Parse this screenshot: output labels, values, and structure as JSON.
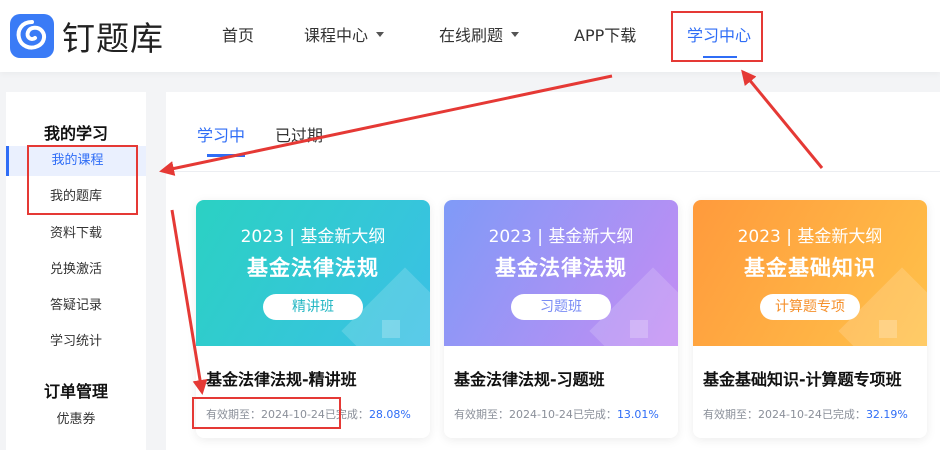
{
  "brand": {
    "name": "钉题库",
    "logo_icon": "swirl-logo-icon"
  },
  "nav": {
    "items": [
      {
        "label": "首页",
        "has_dropdown": false
      },
      {
        "label": "课程中心",
        "has_dropdown": true
      },
      {
        "label": "在线刷题",
        "has_dropdown": true
      },
      {
        "label": "APP下载",
        "has_dropdown": false
      },
      {
        "label": "学习中心",
        "has_dropdown": false,
        "active": true
      }
    ]
  },
  "sidebar": {
    "section1_title": "我的学习",
    "section1_items": [
      "我的课程",
      "我的题库",
      "资料下载",
      "兑换激活",
      "答疑记录",
      "学习统计"
    ],
    "active_item": "我的课程",
    "section2_title": "订单管理",
    "section2_items": [
      "优惠券"
    ]
  },
  "tabs": {
    "items": [
      "学习中",
      "已过期"
    ],
    "active": "学习中"
  },
  "courses": [
    {
      "year_line": "2023 | 基金新大纲",
      "subject": "基金法律法规",
      "pill": "精讲班",
      "title": "基金法律法规-精讲班",
      "validity_label": "有效期至：",
      "validity_date": "2024-10-24",
      "completion_label": "已完成：",
      "progress": "28.08%",
      "gradient": "teal"
    },
    {
      "year_line": "2023 | 基金新大纲",
      "subject": "基金法律法规",
      "pill": "习题班",
      "title": "基金法律法规-习题班",
      "validity_label": "有效期至：",
      "validity_date": "2024-10-24",
      "completion_label": "已完成：",
      "progress": "13.01%",
      "gradient": "purple"
    },
    {
      "year_line": "2023 | 基金新大纲",
      "subject": "基金基础知识",
      "pill": "计算题专项",
      "title": "基金基础知识-计算题专项班",
      "validity_label": "有效期至：",
      "validity_date": "2024-10-24",
      "completion_label": "已完成：",
      "progress": "32.19%",
      "gradient": "orange"
    }
  ],
  "colors": {
    "accent": "#2f6df6",
    "annotation": "#e53935",
    "teal_pill_text": "#27b8c4",
    "purple_pill_text": "#7a8cf5",
    "orange_pill_text": "#f5902c"
  }
}
